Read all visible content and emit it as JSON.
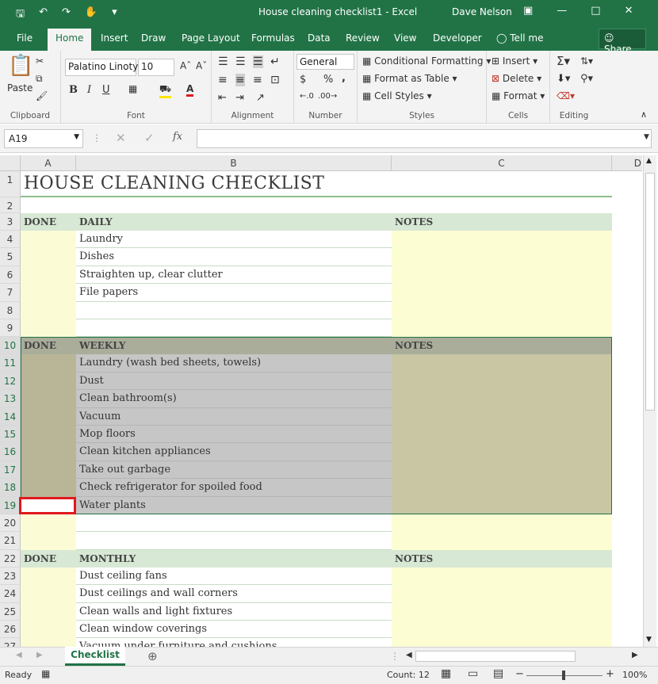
{
  "titlebar": {
    "document": "House cleaning checklist1 - Excel",
    "user": "Dave Nelson"
  },
  "menu_tabs": [
    "File",
    "Home",
    "Insert",
    "Draw",
    "Page Layout",
    "Formulas",
    "Data",
    "Review",
    "View",
    "Developer",
    "Tell me"
  ],
  "share_label": "Share",
  "ribbon": {
    "clipboard": {
      "paste": "Paste",
      "label": "Clipboard"
    },
    "font": {
      "name": "Palatino Linoty",
      "size": "10",
      "bold": "B",
      "italic": "I",
      "underline": "U",
      "label": "Font"
    },
    "alignment": {
      "label": "Alignment"
    },
    "number": {
      "format": "General",
      "currency": "$",
      "percent": "%",
      "comma": ",",
      "label": "Number"
    },
    "styles": {
      "conditional": "Conditional Formatting",
      "format_table": "Format as Table",
      "cell_styles": "Cell Styles",
      "label": "Styles"
    },
    "cells": {
      "insert": "Insert",
      "delete": "Delete",
      "format": "Format",
      "label": "Cells"
    },
    "editing": {
      "label": "Editing"
    }
  },
  "formula_bar": {
    "namebox": "A19",
    "fx": "fx",
    "value": ""
  },
  "columns": [
    "A",
    "B",
    "C",
    "D"
  ],
  "sheet": {
    "title": "HOUSE CLEANING CHECKLIST",
    "done": "DONE",
    "notes": "NOTES",
    "daily_header": "DAILY",
    "daily": [
      "Laundry",
      "Dishes",
      "Straighten up, clear clutter",
      "File papers"
    ],
    "weekly_header": "WEEKLY",
    "weekly": [
      "Laundry (wash bed sheets, towels)",
      "Dust",
      "Clean bathroom(s)",
      "Vacuum",
      "Mop floors",
      "Clean kitchen appliances",
      "Take out garbage",
      "Check refrigerator for spoiled food",
      "Water plants"
    ],
    "monthly_header": "MONTHLY",
    "monthly": [
      "Dust ceiling fans",
      "Dust ceilings and wall corners",
      "Clean walls and light fixtures",
      "Clean window coverings",
      "Vacuum under furniture and cushions"
    ]
  },
  "row_numbers": [
    "1",
    "2",
    "3",
    "4",
    "5",
    "6",
    "7",
    "8",
    "9",
    "10",
    "11",
    "12",
    "13",
    "14",
    "15",
    "16",
    "17",
    "18",
    "19",
    "20",
    "21",
    "22",
    "23",
    "24",
    "25",
    "26",
    "27"
  ],
  "sheet_tab": "Checklist",
  "status": {
    "ready": "Ready",
    "count": "Count: 12",
    "zoom": "100%"
  },
  "colors": {
    "excel_green": "#217346",
    "header_band": "#d7e8d4",
    "done_fill": "#fbfbd6",
    "notes_fill": "#fdfdd4",
    "selection_grey": "#c6c6c6",
    "selection_notes": "#c8c6a3",
    "active_cell_border": "#e0191e"
  }
}
